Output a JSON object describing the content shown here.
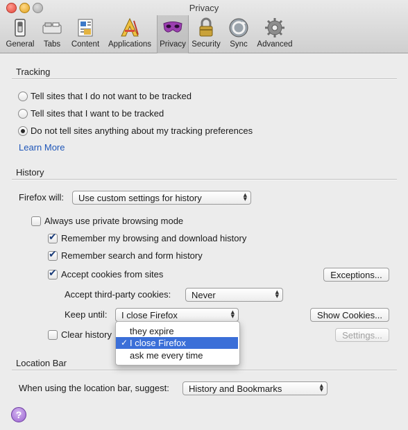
{
  "window": {
    "title": "Privacy"
  },
  "toolbar": {
    "items": [
      {
        "label": "General",
        "icon": "switch-icon"
      },
      {
        "label": "Tabs",
        "icon": "tabs-icon"
      },
      {
        "label": "Content",
        "icon": "content-icon"
      },
      {
        "label": "Applications",
        "icon": "applications-icon"
      },
      {
        "label": "Privacy",
        "icon": "mask-icon"
      },
      {
        "label": "Security",
        "icon": "lock-icon"
      },
      {
        "label": "Sync",
        "icon": "sync-icon"
      },
      {
        "label": "Advanced",
        "icon": "gear-icon"
      }
    ],
    "selected": "Privacy"
  },
  "tracking": {
    "title": "Tracking",
    "options": [
      {
        "label": "Tell sites that I do not want to be tracked",
        "selected": false
      },
      {
        "label": "Tell sites that I want to be tracked",
        "selected": false
      },
      {
        "label": "Do not tell sites anything about my tracking preferences",
        "selected": true
      }
    ],
    "learn_more": "Learn More"
  },
  "history": {
    "title": "History",
    "firefox_will_label": "Firefox will:",
    "firefox_will_value": "Use custom settings for history",
    "private_mode": {
      "label": "Always use private browsing mode",
      "checked": false
    },
    "remember_browsing": {
      "label": "Remember my browsing and download history",
      "checked": true
    },
    "remember_search": {
      "label": "Remember search and form history",
      "checked": true
    },
    "accept_cookies": {
      "label": "Accept cookies from sites",
      "checked": true
    },
    "exceptions_button": "Exceptions...",
    "third_party_label": "Accept third-party cookies:",
    "third_party_value": "Never",
    "keep_until_label": "Keep until:",
    "keep_until_value": "I close Firefox",
    "show_cookies_button": "Show Cookies...",
    "clear_history": {
      "label": "Clear history",
      "checked": false
    },
    "settings_button": "Settings...",
    "keep_until_menu": {
      "options": [
        "they expire",
        "I close Firefox",
        "ask me every time"
      ],
      "selected": "I close Firefox",
      "checkmark": "✓"
    }
  },
  "location_bar": {
    "title": "Location Bar",
    "suggest_label": "When using the location bar, suggest:",
    "suggest_value": "History and Bookmarks"
  },
  "help_button": "?",
  "colors": {
    "link": "#1f56b8",
    "menu_highlight": "#3b6fd8",
    "help": "#9a62d2"
  }
}
